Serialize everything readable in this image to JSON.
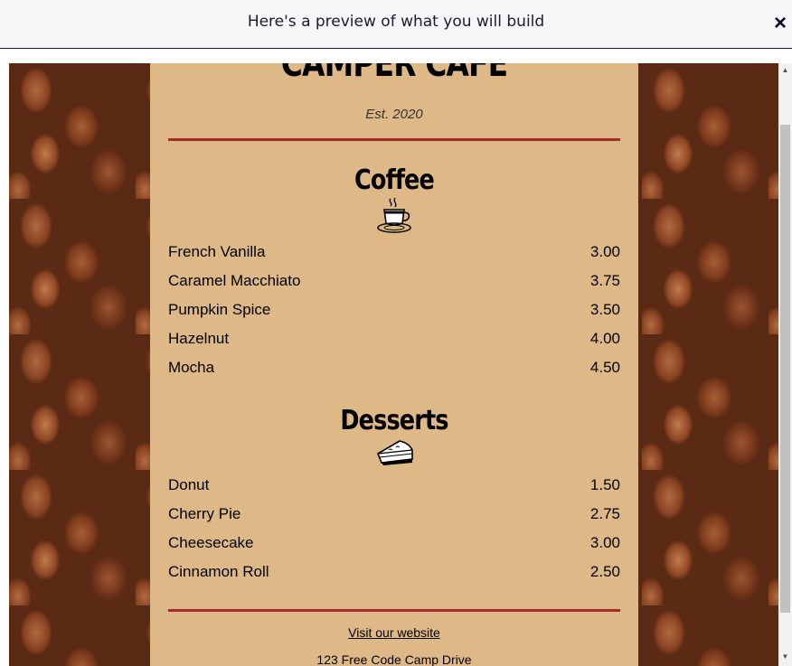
{
  "modal": {
    "title": "Here's a preview of what you will build",
    "close_label": "×"
  },
  "menu": {
    "cafe_name": "CAMPER CAFE",
    "established": "Est. 2020",
    "coffee": {
      "title": "Coffee",
      "icon": "coffee-cup-icon",
      "items": [
        {
          "name": "French Vanilla",
          "price": "3.00"
        },
        {
          "name": "Caramel Macchiato",
          "price": "3.75"
        },
        {
          "name": "Pumpkin Spice",
          "price": "3.50"
        },
        {
          "name": "Hazelnut",
          "price": "4.00"
        },
        {
          "name": "Mocha",
          "price": "4.50"
        }
      ]
    },
    "desserts": {
      "title": "Desserts",
      "icon": "pie-slice-icon",
      "items": [
        {
          "name": "Donut",
          "price": "1.50"
        },
        {
          "name": "Cherry Pie",
          "price": "2.75"
        },
        {
          "name": "Cheesecake",
          "price": "3.00"
        },
        {
          "name": "Cinnamon Roll",
          "price": "2.50"
        }
      ]
    },
    "footer": {
      "link_text": "Visit our website",
      "address": "123 Free Code Camp Drive"
    }
  },
  "colors": {
    "menu_background": "#deb887",
    "rule": "#a52a2a"
  }
}
